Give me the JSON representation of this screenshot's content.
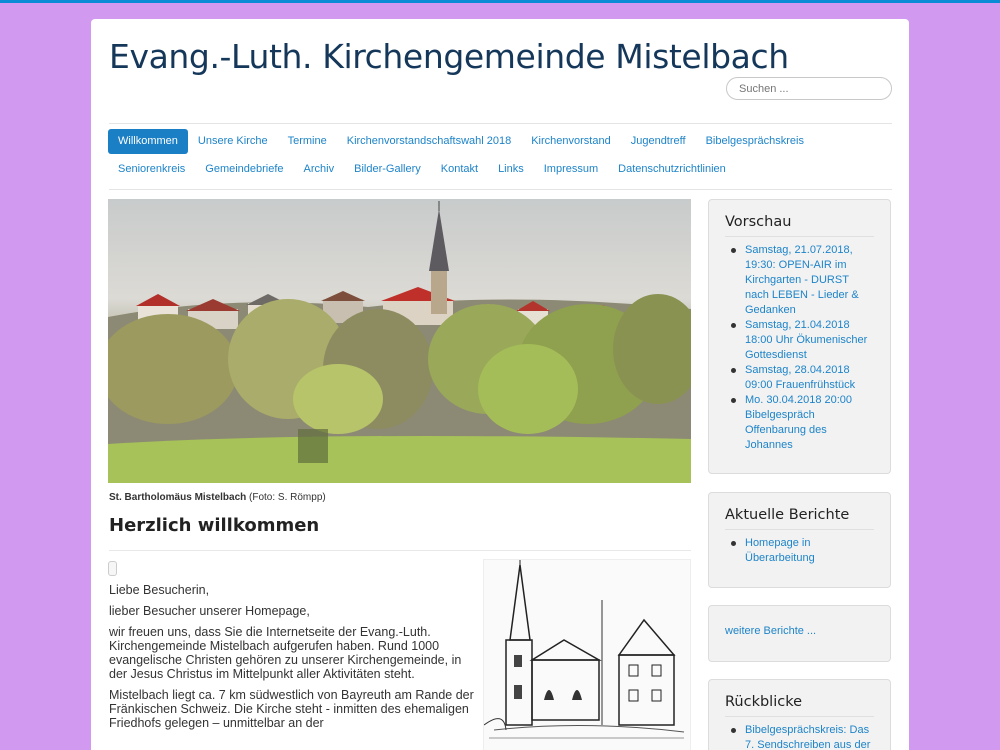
{
  "site": {
    "title": "Evang.-Luth. Kirchengemeinde Mistelbach"
  },
  "search": {
    "placeholder": "Suchen ..."
  },
  "nav": {
    "row1": [
      "Willkommen",
      "Unsere Kirche",
      "Termine",
      "Kirchenvorstandschaftswahl 2018",
      "Kirchenvorstand",
      "Jugendtreff",
      "Bibelgesprächskreis"
    ],
    "row2": [
      "Seniorenkreis",
      "Gemeindebriefe",
      "Archiv",
      "Bilder-Gallery",
      "Kontakt",
      "Links",
      "Impressum",
      "Datenschutzrichtlinien"
    ],
    "active": "Willkommen"
  },
  "hero": {
    "caption_bold": "St. Bartholomäus Mistelbach",
    "caption_rest": " (Foto: S. Römpp)"
  },
  "welcome": {
    "title": "Herzlich willkommen",
    "paragraphs": [
      "Liebe Besucherin,",
      "lieber Besucher unserer Homepage,",
      "wir freuen uns, dass Sie die Internetseite der Evang.-Luth. Kirchengemeinde Mistelbach aufgerufen haben. Rund 1000 evangelische Christen gehören zu unserer Kirchengemeinde, in der Jesus Christus im Mittelpunkt aller Aktivitäten steht.",
      "Mistelbach liegt ca. 7 km südwestlich von Bayreuth am Rande der Fränkischen Schweiz. Die Kirche steht - inmitten des ehemaligen Friedhofs gelegen – unmittelbar an der"
    ]
  },
  "sidebar": {
    "vorschau": {
      "title": "Vorschau",
      "items": [
        "Samstag, 21.07.2018, 19:30: OPEN-AIR im Kirchgarten - DURST nach LEBEN - Lieder & Gedanken",
        "Samstag, 21.04.2018 18:00 Uhr Ökumenischer Gottesdienst",
        "Samstag, 28.04.2018 09:00 Frauenfrühstück",
        "Mo. 30.04.2018 20:00 Bibelgespräch Offenbarung des Johannes"
      ]
    },
    "berichte": {
      "title": "Aktuelle Berichte",
      "items": [
        "Homepage in Überarbeitung"
      ]
    },
    "weitere": {
      "label": "weitere Berichte ..."
    },
    "rueckblicke": {
      "title": "Rückblicke",
      "items": [
        "Bibelgesprächskreis: Das 7. Sendschreiben aus der"
      ]
    }
  },
  "colors": {
    "background": "#d199f0",
    "link": "#1d84c9",
    "active_nav": "#1a7fc4",
    "title": "#14375a"
  }
}
